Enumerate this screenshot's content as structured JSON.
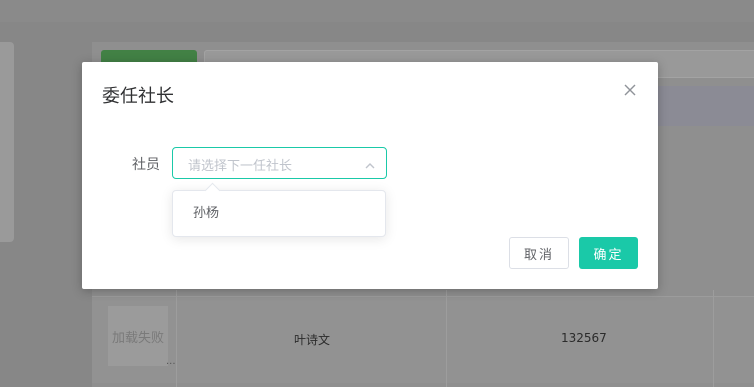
{
  "background": {
    "image_fail_text": "加载失败",
    "ellipsis": "...",
    "row": {
      "name": "叶诗文",
      "id": "132567"
    }
  },
  "dialog": {
    "title": "委任社长",
    "close_icon": "close-icon",
    "form": {
      "label": "社员",
      "select_placeholder": "请选择下一任社长",
      "options": [
        "孙杨"
      ]
    },
    "cancel_label": "取消",
    "confirm_label": "确定"
  },
  "colors": {
    "accent": "#1ac9a8",
    "overlay": "#8c8c8c"
  }
}
